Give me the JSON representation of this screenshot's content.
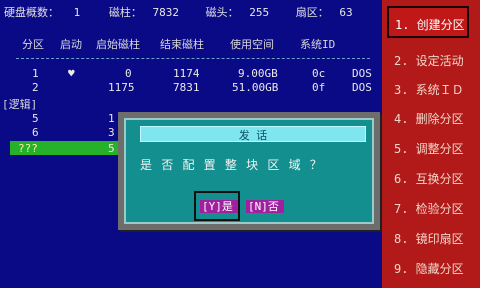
{
  "disk_info": {
    "count_label": "硬盘概数：",
    "count_value": "1",
    "cyl_label": "磁柱：",
    "cyl_value": "7832",
    "head_label": "磁头：",
    "head_value": "255",
    "sector_label": "扇区：",
    "sector_value": "63"
  },
  "table": {
    "headers": [
      "分区",
      "启动",
      "启始磁柱",
      "结束磁柱",
      "使用空间",
      "系统ID"
    ],
    "rows": [
      {
        "part": "1",
        "boot": "♥",
        "start": "0",
        "end": "1174",
        "size": "9.00GB",
        "id": "0c",
        "sys": "DOS"
      },
      {
        "part": "2",
        "boot": "",
        "start": "1175",
        "end": "7831",
        "size": "51.00GB",
        "id": "0f",
        "sys": "DOS"
      }
    ],
    "logical_label": "[逻辑]",
    "logical_rows": [
      {
        "part": "5",
        "start": "1"
      },
      {
        "part": "6",
        "start": "3"
      },
      {
        "part": "???",
        "start": "5"
      }
    ]
  },
  "menu": {
    "items": [
      "1. 创建分区",
      "2. 设定活动",
      "3. 系统ＩＤ",
      "4. 删除分区",
      "5. 调整分区",
      "6. 互换分区",
      "7. 检验分区",
      "8. 镜印扇区",
      "9. 隐藏分区"
    ],
    "selected_index": 0
  },
  "dialog": {
    "title": "发 话",
    "question": "是 否 配 置 整 块 区 域 ？",
    "yes_label": "[Y]是",
    "no_label": "[N]否"
  },
  "colors": {
    "background": "#0a0a86",
    "menu_bg": "#b21a1a",
    "dialog_bg": "#138f8f",
    "button_bg": "#a020a0",
    "highlight_row": "#27b12a"
  }
}
